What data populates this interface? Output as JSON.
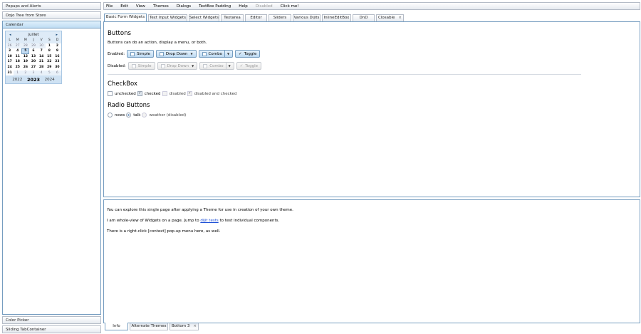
{
  "accordion": {
    "panes": [
      "Popups and Alerts",
      "Dojo Tree from Store",
      "Calendar"
    ],
    "bottom_panes": [
      "Color Picker",
      "Sliding TabContainer"
    ]
  },
  "calendar": {
    "prev_icon": "chevron-left-icon",
    "next_icon": "chevron-right-icon",
    "prev_glyph": "◂",
    "next_glyph": "▸",
    "month": "juillet",
    "day_headers": [
      "L",
      "M",
      "M",
      "J",
      "V",
      "S",
      "D"
    ],
    "weeks": [
      [
        "26",
        "27",
        "28",
        "29",
        "30",
        "1",
        "2"
      ],
      [
        "3",
        "4",
        "5",
        "6",
        "7",
        "8",
        "9"
      ],
      [
        "10",
        "11",
        "12",
        "13",
        "14",
        "15",
        "16"
      ],
      [
        "17",
        "18",
        "19",
        "20",
        "21",
        "22",
        "23"
      ],
      [
        "24",
        "25",
        "26",
        "27",
        "28",
        "29",
        "30"
      ],
      [
        "31",
        "1",
        "2",
        "3",
        "4",
        "5",
        "6"
      ]
    ],
    "selected_day": "5",
    "years": {
      "prev": "2022",
      "current": "2023",
      "next": "2024"
    }
  },
  "menubar": {
    "items": [
      "File",
      "Edit",
      "View",
      "Themes",
      "Dialogs",
      "TextBox Padding",
      "Help"
    ],
    "disabled_item": "Disabled",
    "last_item": "Click me!"
  },
  "top_tabs": {
    "tabs": [
      "Basic Form Widgets",
      "Text Input Widgets",
      "Select Widgets",
      "Textarea",
      "Editor",
      "Sliders",
      "Various Dijits",
      "InlineEditBox",
      "DnD",
      "Closable"
    ],
    "close_glyph": "×"
  },
  "basic_form": {
    "buttons_heading": "Buttons",
    "buttons_desc": "Buttons can do an action, display a menu, or both.",
    "enabled_label": "Enabled:",
    "disabled_label": "Disabled:",
    "buttons": {
      "simple": "Simple",
      "dropdown": "Drop Down",
      "combo": "Combo",
      "toggle": "Toggle"
    },
    "check_glyph": "✓",
    "caret_glyph": "▼",
    "checkbox_heading": "CheckBox",
    "checkboxes": [
      "unchecked",
      "checked",
      "disabled",
      "disabled and checked"
    ],
    "radio_heading": "Radio Buttons",
    "radios": [
      "news",
      "talk",
      "weather (disabled)"
    ]
  },
  "info_pane": {
    "line1": "You can explore this single page after applying a Theme for use in creation of your own theme.",
    "line2_pre": "I am whole-view of Widgets on a page. Jump to ",
    "line2_link": "dijit tests",
    "line2_post": " to test individual components.",
    "line3": "There is a right-click [context] pop-up menu here, as well."
  },
  "bottom_tabs": {
    "tabs": [
      "Info",
      "Alternate Themes",
      "Bottom 3"
    ]
  },
  "colors": {
    "accent_border": "#769dc0",
    "button_bg": "#bcd8f1",
    "link": "#1d4fd6"
  }
}
